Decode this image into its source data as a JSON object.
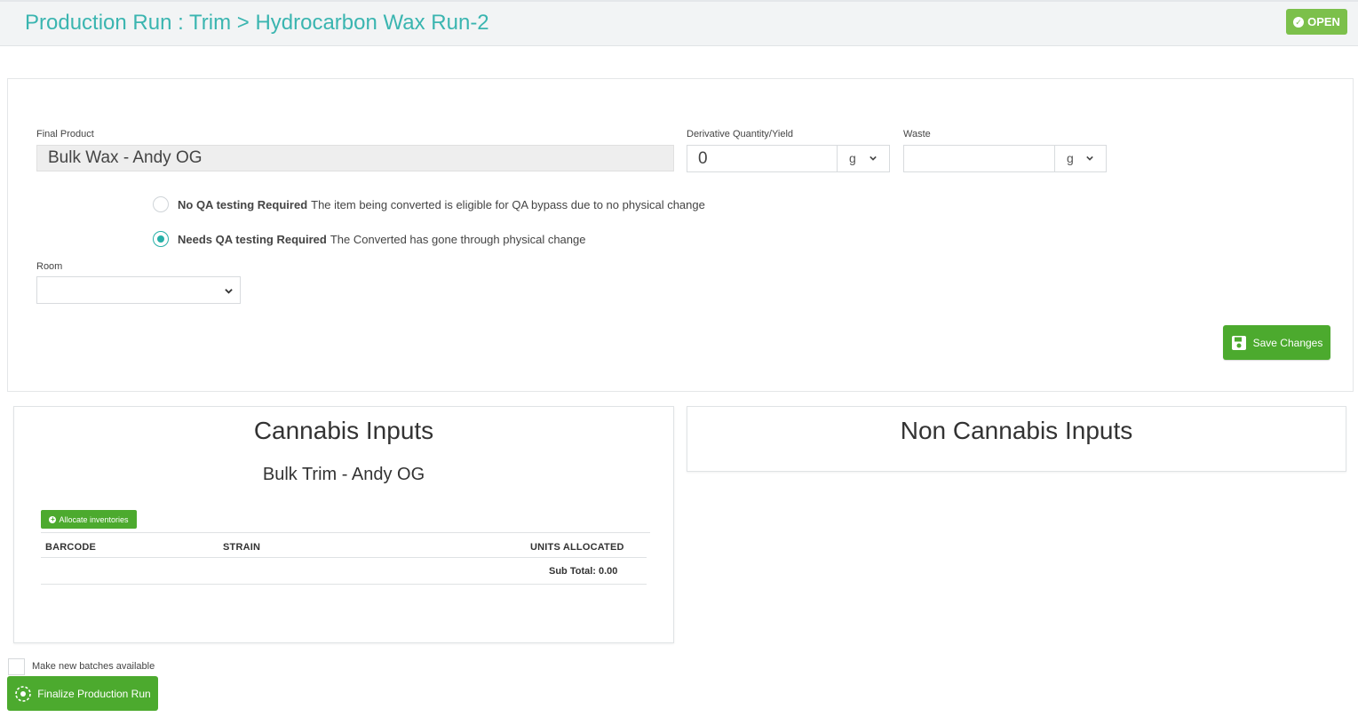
{
  "header": {
    "title": "Production Run : Trim > Hydrocarbon Wax Run-2",
    "status": "OPEN"
  },
  "form": {
    "final_product_label": "Final Product",
    "final_product_value": "Bulk Wax - Andy OG",
    "derivative_label": "Derivative Quantity/Yield",
    "derivative_value": "0",
    "derivative_unit": "g",
    "waste_label": "Waste",
    "waste_value": "",
    "waste_unit": "g",
    "qa_options": [
      {
        "bold": "No QA testing Required",
        "text": "The item being converted is eligible for QA bypass due to no physical change",
        "checked": false
      },
      {
        "bold": "Needs QA testing Required",
        "text": "The Converted has gone through physical change",
        "checked": true
      }
    ],
    "room_label": "Room",
    "room_value": "",
    "save_label": "Save Changes"
  },
  "cannabis_inputs": {
    "title": "Cannabis Inputs",
    "item": "Bulk Trim - Andy OG",
    "allocate_label": "Allocate inventories",
    "columns": [
      "BARCODE",
      "STRAIN",
      "UNITS ALLOCATED"
    ],
    "rows": [],
    "subtotal": "Sub Total: 0.00"
  },
  "non_cannabis_inputs": {
    "title": "Non Cannabis Inputs"
  },
  "footer": {
    "checkbox_label": "Make new batches available",
    "finalize_label": "Finalize Production Run"
  },
  "colors": {
    "accent_teal": "#3ab5b0",
    "green": "#4caa2e",
    "badge_green": "#7cc04b"
  }
}
